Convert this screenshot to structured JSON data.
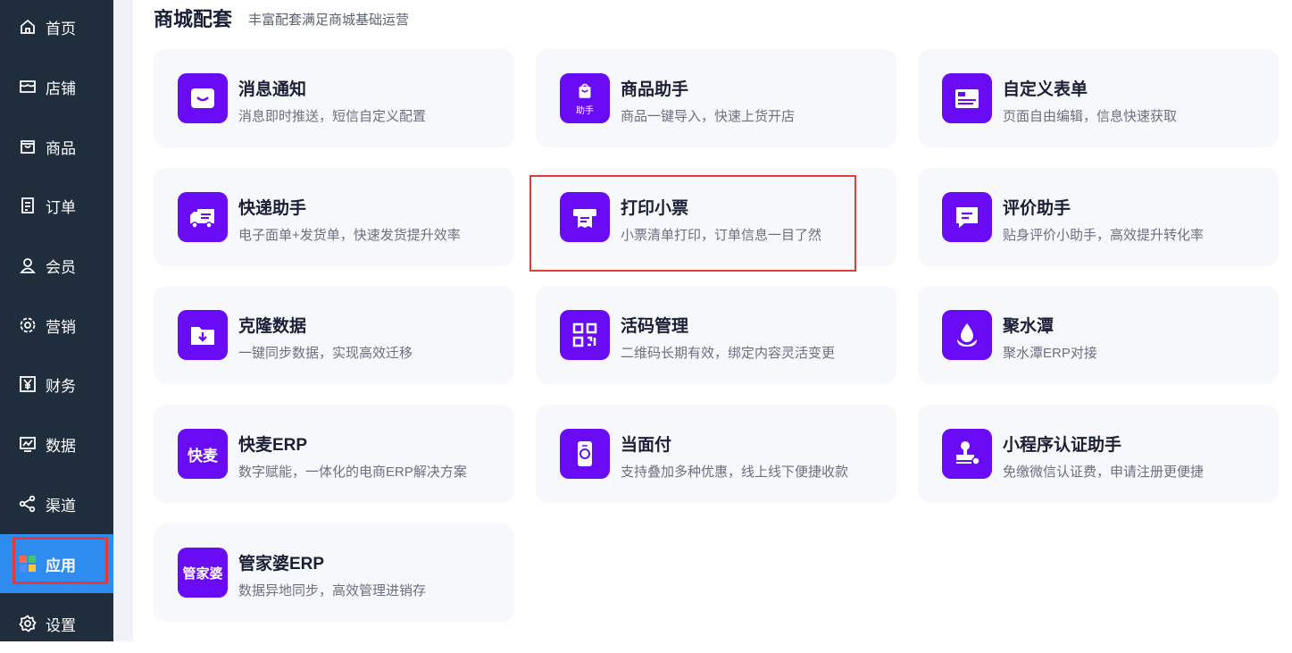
{
  "sidebar": {
    "items": [
      {
        "label": "首页",
        "icon": "home-icon"
      },
      {
        "label": "店铺",
        "icon": "store-icon"
      },
      {
        "label": "商品",
        "icon": "bag-icon"
      },
      {
        "label": "订单",
        "icon": "order-icon"
      },
      {
        "label": "会员",
        "icon": "user-icon"
      },
      {
        "label": "营销",
        "icon": "marketing-icon"
      },
      {
        "label": "财务",
        "icon": "yen-icon"
      },
      {
        "label": "数据",
        "icon": "chart-icon"
      },
      {
        "label": "渠道",
        "icon": "channel-icon"
      },
      {
        "label": "应用",
        "icon": "apps-icon",
        "active": true
      },
      {
        "label": "设置",
        "icon": "gear-icon"
      }
    ]
  },
  "section": {
    "title": "商城配套",
    "subtitle": "丰富配套满足商城基础运营"
  },
  "cards": [
    {
      "title": "消息通知",
      "desc": "消息即时推送，短信自定义配置",
      "icon": "message-icon"
    },
    {
      "title": "商品助手",
      "desc": "商品一键导入，快速上货开店",
      "icon": "goods-helper-icon",
      "icon_text": "助手"
    },
    {
      "title": "自定义表单",
      "desc": "页面自由编辑，信息快速获取",
      "icon": "form-icon"
    },
    {
      "title": "快递助手",
      "desc": "电子面单+发货单，快速发货提升效率",
      "icon": "truck-icon"
    },
    {
      "title": "打印小票",
      "desc": "小票清单打印，订单信息一目了然",
      "icon": "printer-icon"
    },
    {
      "title": "评价助手",
      "desc": "贴身评价小助手，高效提升转化率",
      "icon": "comment-icon"
    },
    {
      "title": "克隆数据",
      "desc": "一键同步数据，实现高效迁移",
      "icon": "folder-download-icon"
    },
    {
      "title": "活码管理",
      "desc": "二维码长期有效，绑定内容灵活变更",
      "icon": "qrcode-icon"
    },
    {
      "title": "聚水潭",
      "desc": "聚水潭ERP对接",
      "icon": "water-drop-icon"
    },
    {
      "title": "快麦ERP",
      "desc": "数字赋能，一体化的电商ERP解决方案",
      "icon": "kuaimai-logo-icon",
      "icon_text": "快麦"
    },
    {
      "title": "当面付",
      "desc": "支持叠加多种优惠，线上线下便捷收款",
      "icon": "phone-pay-icon"
    },
    {
      "title": "小程序认证助手",
      "desc": "免缴微信认证费，申请注册更便捷",
      "icon": "stamp-icon"
    },
    {
      "title": "管家婆ERP",
      "desc": "数据异地同步，高效管理进销存",
      "icon": "guanjiapo-logo-icon",
      "icon_text": "管家婆"
    }
  ],
  "colors": {
    "sidebar_bg": "#1f2d3d",
    "active_bg": "#2e8cf0",
    "icon_bg": "#6a0bf5",
    "card_bg": "#f7f8fc",
    "highlight": "#e53935"
  }
}
